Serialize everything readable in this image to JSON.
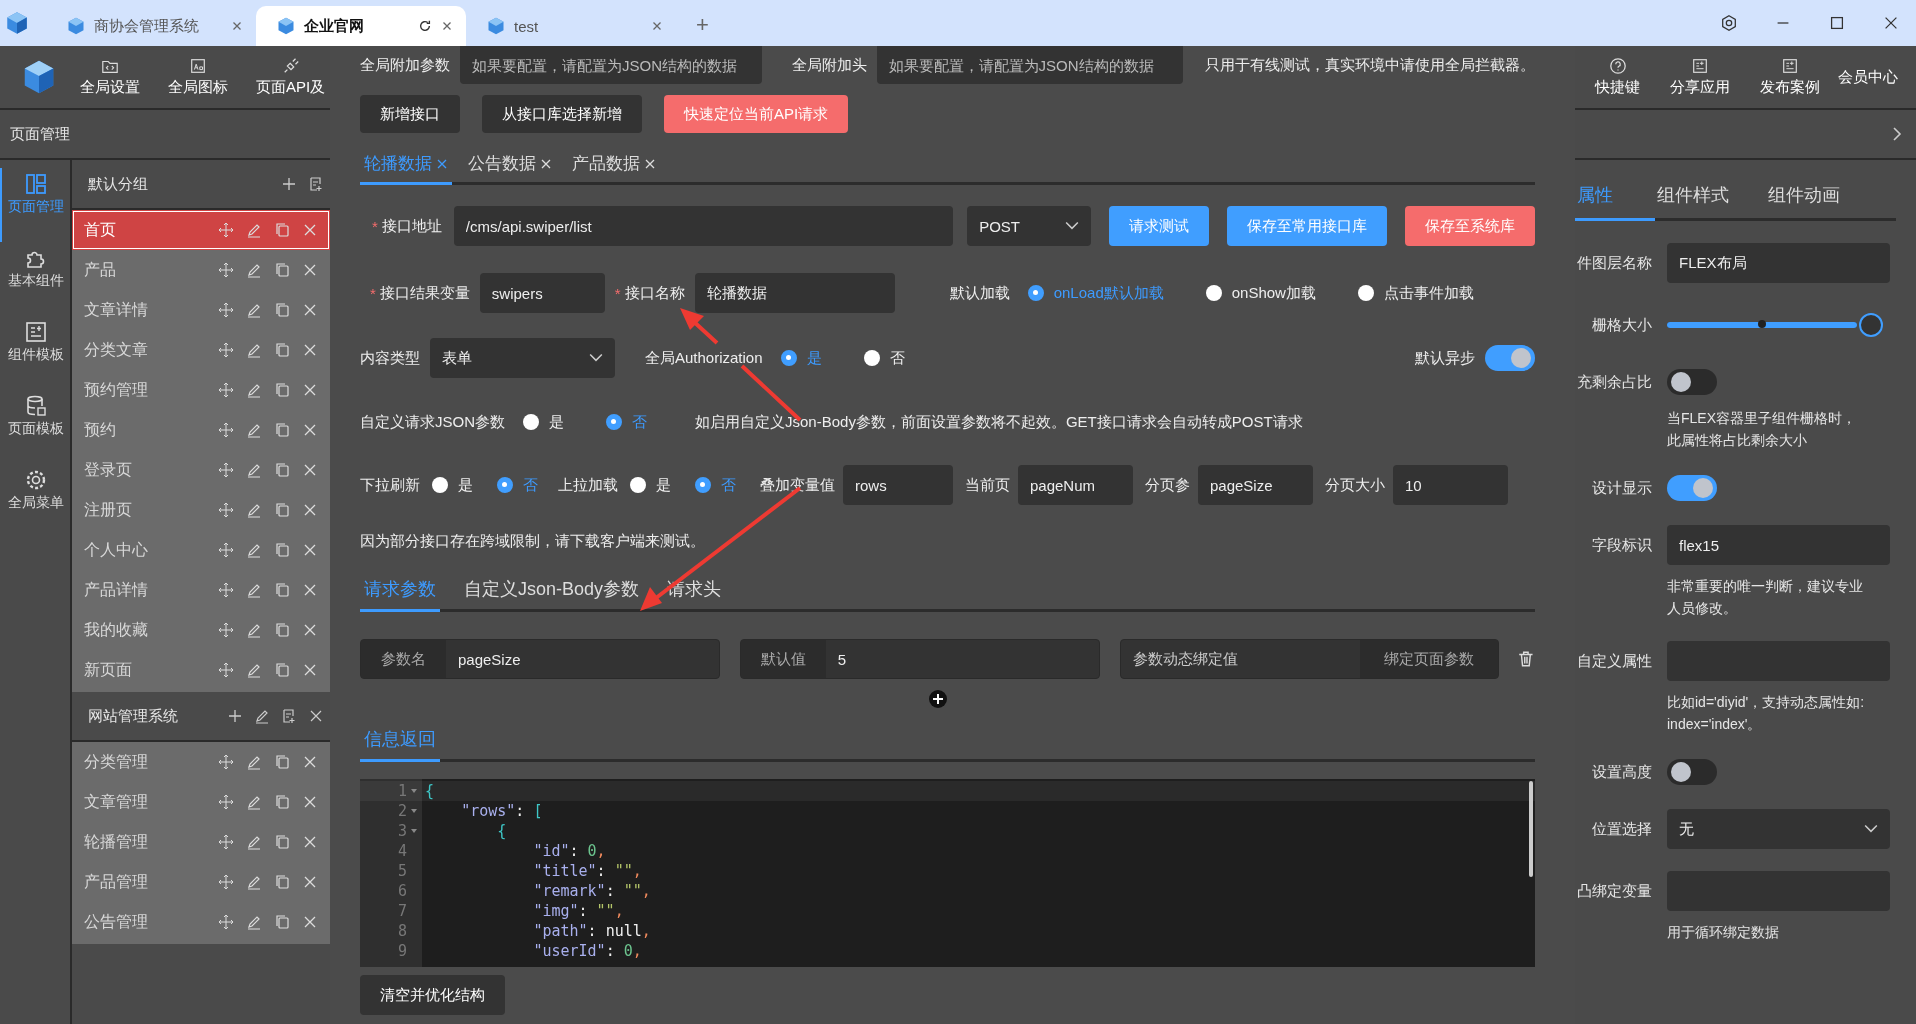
{
  "app_tabs": [
    {
      "title": "商协会管理系统",
      "selected": false
    },
    {
      "title": "企业官网",
      "selected": true
    },
    {
      "title": "test",
      "selected": false
    }
  ],
  "new_tab": "+",
  "toolbar_left": [
    "全局设置",
    "全局图标",
    "页面API及"
  ],
  "subheader": "页面管理",
  "rail": [
    {
      "label": "页面管理",
      "selected": true
    },
    {
      "label": "基本组件",
      "selected": false
    },
    {
      "label": "组件模板",
      "selected": false
    },
    {
      "label": "页面模板",
      "selected": false
    },
    {
      "label": "全局菜单",
      "selected": false
    }
  ],
  "groups": [
    {
      "name": "默认分组",
      "pages": [
        {
          "name": "首页",
          "selected": true
        },
        {
          "name": "产品",
          "selected": false
        },
        {
          "name": "文章详情",
          "selected": false
        },
        {
          "name": "分类文章",
          "selected": false
        },
        {
          "name": "预约管理",
          "selected": false
        },
        {
          "name": "预约",
          "selected": false
        },
        {
          "name": "登录页",
          "selected": false
        },
        {
          "name": "注册页",
          "selected": false
        },
        {
          "name": "个人中心",
          "selected": false
        },
        {
          "name": "产品详情",
          "selected": false
        },
        {
          "name": "我的收藏",
          "selected": false
        },
        {
          "name": "新页面",
          "selected": false
        }
      ]
    },
    {
      "name": "网站管理系统",
      "pages": [
        {
          "name": "分类管理",
          "selected": false
        },
        {
          "name": "文章管理",
          "selected": false
        },
        {
          "name": "轮播管理",
          "selected": false
        },
        {
          "name": "产品管理",
          "selected": false
        },
        {
          "name": "公告管理",
          "selected": false
        }
      ]
    }
  ],
  "dialog": {
    "global_params": {
      "label": "全局附加参数",
      "placeholder": "如果要配置，请配置为JSON结构的数据"
    },
    "global_headers": {
      "label": "全局附加头",
      "placeholder": "如果要配置，请配置为JSON结构的数据"
    },
    "global_note": "只用于有线测试，真实环境中请使用全局拦截器。",
    "actions": [
      {
        "label": "新增接口",
        "kind": "plain"
      },
      {
        "label": "从接口库选择新增",
        "kind": "plain"
      },
      {
        "label": "快速定位当前API请求",
        "kind": "danger"
      }
    ],
    "api_tabs": [
      {
        "label": "轮播数据",
        "selected": true
      },
      {
        "label": "公告数据",
        "selected": false
      },
      {
        "label": "产品数据",
        "selected": false
      }
    ],
    "url": {
      "required": "*",
      "label": "接口地址",
      "value": "/cms/api.swiper/list"
    },
    "method": "POST",
    "url_buttons": [
      {
        "label": "请求测试",
        "kind": "primary"
      },
      {
        "label": "保存至常用接口库",
        "kind": "primary"
      },
      {
        "label": "保存至系统库",
        "kind": "danger"
      }
    ],
    "result_var": {
      "required": "*",
      "label": "接口结果变量",
      "value": "swipers"
    },
    "api_name": {
      "required": "*",
      "label": "接口名称",
      "value": "轮播数据"
    },
    "load": {
      "label": "默认加载",
      "options": [
        {
          "label": "onLoad默认加载",
          "selected": true
        },
        {
          "label": "onShow加载",
          "selected": false
        },
        {
          "label": "点击事件加载",
          "selected": false
        }
      ]
    },
    "content_type": {
      "label": "内容类型",
      "value": "表单"
    },
    "auth": {
      "label": "全局Authorization",
      "options": [
        {
          "label": "是",
          "selected": true
        },
        {
          "label": "否",
          "selected": false
        }
      ]
    },
    "async": {
      "label": "默认异步",
      "on": true
    },
    "custom_json": {
      "label": "自定义请求JSON参数",
      "options": [
        {
          "label": "是",
          "selected": false
        },
        {
          "label": "否",
          "selected": true
        }
      ],
      "note": "如启用自定义Json-Body参数，前面设置参数将不起效。GET接口请求会自动转成POST请求"
    },
    "pull_down": {
      "label": "下拉刷新",
      "options": [
        {
          "label": "是",
          "selected": false
        },
        {
          "label": "否",
          "selected": true
        }
      ]
    },
    "pull_up": {
      "label": "上拉加载",
      "options": [
        {
          "label": "是",
          "selected": false
        },
        {
          "label": "否",
          "selected": true
        }
      ]
    },
    "paging": [
      {
        "label": "叠加变量值",
        "value": "rows"
      },
      {
        "label": "当前页",
        "value": "pageNum"
      },
      {
        "label": "分页参",
        "value": "pageSize"
      },
      {
        "label": "分页大小",
        "value": "10"
      }
    ],
    "cors_note": "因为部分接口存在跨域限制，请下载客户端来测试。",
    "param_tabs": [
      {
        "label": "请求参数",
        "selected": true
      },
      {
        "label": "自定义Json-Body参数",
        "selected": false
      },
      {
        "label": "请求头",
        "selected": false
      }
    ],
    "param": {
      "name_label": "参数名",
      "name": "pageSize",
      "default_label": "默认值",
      "default": "5",
      "bind_label": "参数动态绑定值",
      "bind_button": "绑定页面参数"
    },
    "response_tab": "信息返回",
    "code": [
      {
        "no": "1",
        "fold": true,
        "text": "{"
      },
      {
        "no": "2",
        "fold": true,
        "text": "    \"rows\": ["
      },
      {
        "no": "3",
        "fold": true,
        "text": "        {"
      },
      {
        "no": "4",
        "fold": false,
        "text": "            \"id\": 0,"
      },
      {
        "no": "5",
        "fold": false,
        "text": "            \"title\": \"\","
      },
      {
        "no": "6",
        "fold": false,
        "text": "            \"remark\": \"\","
      },
      {
        "no": "7",
        "fold": false,
        "text": "            \"img\": \"\","
      },
      {
        "no": "8",
        "fold": false,
        "text": "            \"path\": null,"
      },
      {
        "no": "9",
        "fold": false,
        "text": "            \"userId\": 0,"
      }
    ],
    "clear_button": "清空并优化结构"
  },
  "toolbar_right": [
    "快捷键",
    "分享应用",
    "发布案例",
    "会员中心"
  ],
  "prop_tabs": [
    {
      "label": "属性",
      "selected": true
    },
    {
      "label": "组件样式",
      "selected": false
    },
    {
      "label": "组件动画",
      "selected": false
    }
  ],
  "props": [
    {
      "kind": "input",
      "label": "件图层名称",
      "value": "FLEX布局"
    },
    {
      "kind": "slider",
      "label": "栅格大小",
      "level": 1
    },
    {
      "kind": "switch",
      "label": "充剩余占比",
      "on": false,
      "hint": "当FLEX容器里子组件栅格时，此属性将占比剩余大小"
    },
    {
      "kind": "switch",
      "label": "设计显示",
      "on": true
    },
    {
      "kind": "input",
      "label": "字段标识",
      "value": "flex15",
      "hint": "非常重要的唯一判断，建议专业人员修改。"
    },
    {
      "kind": "input",
      "label": "自定义属性",
      "hint": "比如id='diyid'，支持动态属性如: index='index'。"
    },
    {
      "kind": "switch",
      "label": "设置高度",
      "on": false
    },
    {
      "kind": "select",
      "label": "位置选择",
      "value": "无"
    },
    {
      "kind": "input",
      "label": "凸绑定变量",
      "hint": "用于循环绑定数据"
    }
  ]
}
